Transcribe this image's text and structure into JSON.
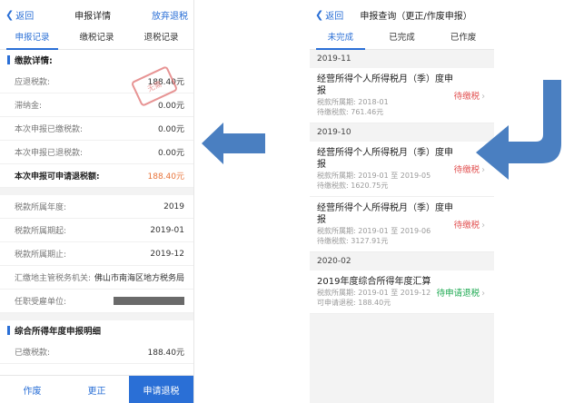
{
  "left": {
    "back": "返回",
    "title": "申报详情",
    "action": "放弃退税",
    "tabs": [
      "申报记录",
      "缴税记录",
      "退税记录"
    ],
    "section1": "缴款详情:",
    "rows1": [
      {
        "label": "应退税款:",
        "value": "188.40元"
      },
      {
        "label": "滞纳金:",
        "value": "0.00元"
      },
      {
        "label": "本次申报已缴税款:",
        "value": "0.00元"
      },
      {
        "label": "本次申报已退税款:",
        "value": "0.00元"
      }
    ],
    "highlight": {
      "label": "本次申报可申请退税额:",
      "value": "188.40元"
    },
    "stamp": "无需",
    "rows2": [
      {
        "label": "税款所属年度:",
        "value": "2019"
      },
      {
        "label": "税款所属期起:",
        "value": "2019-01"
      },
      {
        "label": "税款所属期止:",
        "value": "2019-12"
      },
      {
        "label": "汇缴地主管税务机关:",
        "value": "佛山市南海区地方税务局"
      },
      {
        "label": "任职受雇单位:",
        "value": ""
      }
    ],
    "section2": "综合所得年度申报明细",
    "rows3": [
      {
        "label": "已缴税款:",
        "value": "188.40元"
      }
    ],
    "bottom": [
      "作废",
      "更正",
      "申请退税"
    ]
  },
  "right": {
    "back": "返回",
    "title": "申报查询（更正/作废申报）",
    "tabs": [
      "未完成",
      "已完成",
      "已作废"
    ],
    "groups": [
      {
        "date": "2019-11",
        "items": [
          {
            "title": "经营所得个人所得税月（季）度申报",
            "d1": "税款所属期: 2018-01",
            "d2": "待缴税款: 761.46元",
            "status": "待缴税"
          }
        ]
      },
      {
        "date": "2019-10",
        "items": [
          {
            "title": "经营所得个人所得税月（季）度申报",
            "d1": "税款所属期: 2019-01 至 2019-05",
            "d2": "待缴税款: 1620.75元",
            "status": "待缴税"
          },
          {
            "title": "经营所得个人所得税月（季）度申报",
            "d1": "税款所属期: 2019-01 至 2019-06",
            "d2": "待缴税款: 3127.91元",
            "status": "待缴税"
          }
        ]
      },
      {
        "date": "2020-02",
        "items": [
          {
            "title": "2019年度综合所得年度汇算",
            "d1": "税款所属期: 2019-01 至 2019-12",
            "d2": "可申请退税: 188.40元",
            "status": "待申请退税"
          }
        ]
      }
    ]
  },
  "colors": {
    "accent": "#2a6fd6",
    "warn": "#e14d4d",
    "ok": "#1aa84f",
    "arrow": "#4a7fc1"
  }
}
